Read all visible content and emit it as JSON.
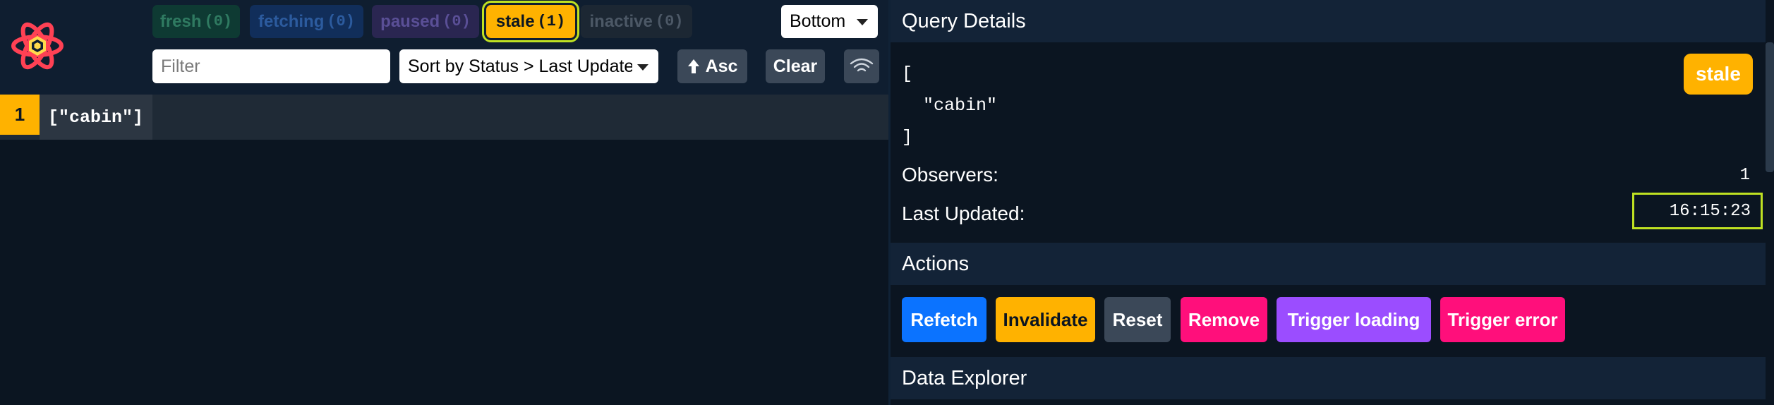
{
  "filters": {
    "fresh": {
      "label": "fresh",
      "count": "(0)"
    },
    "fetching": {
      "label": "fetching",
      "count": "(0)"
    },
    "paused": {
      "label": "paused",
      "count": "(0)"
    },
    "stale": {
      "label": "stale",
      "count": "(1)"
    },
    "inactive": {
      "label": "inactive",
      "count": "(0)"
    }
  },
  "toolbar": {
    "position_value": "Bottom",
    "filter_placeholder": "Filter",
    "sort_value": "Sort by Status > Last Updated",
    "asc_label": "Asc",
    "clear_label": "Clear"
  },
  "queries": [
    {
      "observers": "1",
      "key": "[\"cabin\"]"
    }
  ],
  "details": {
    "header": "Query Details",
    "query_key_json": "[\n  \"cabin\"\n]",
    "status_chip": "stale",
    "observers_label": "Observers:",
    "observers_value": "1",
    "last_updated_label": "Last Updated:",
    "last_updated_value": "16:15:23"
  },
  "actions": {
    "header": "Actions",
    "refetch": "Refetch",
    "invalidate": "Invalidate",
    "reset": "Reset",
    "remove": "Remove",
    "trigger_loading": "Trigger loading",
    "trigger_error": "Trigger error"
  },
  "explorer": {
    "header": "Data Explorer"
  },
  "colors": {
    "background": "#0b1521",
    "stale": "#ffb200",
    "highlight": "#bfe122",
    "refetch": "#0b73ff",
    "remove": "#ff0f7b",
    "trigger_loading": "#9b4dff"
  }
}
